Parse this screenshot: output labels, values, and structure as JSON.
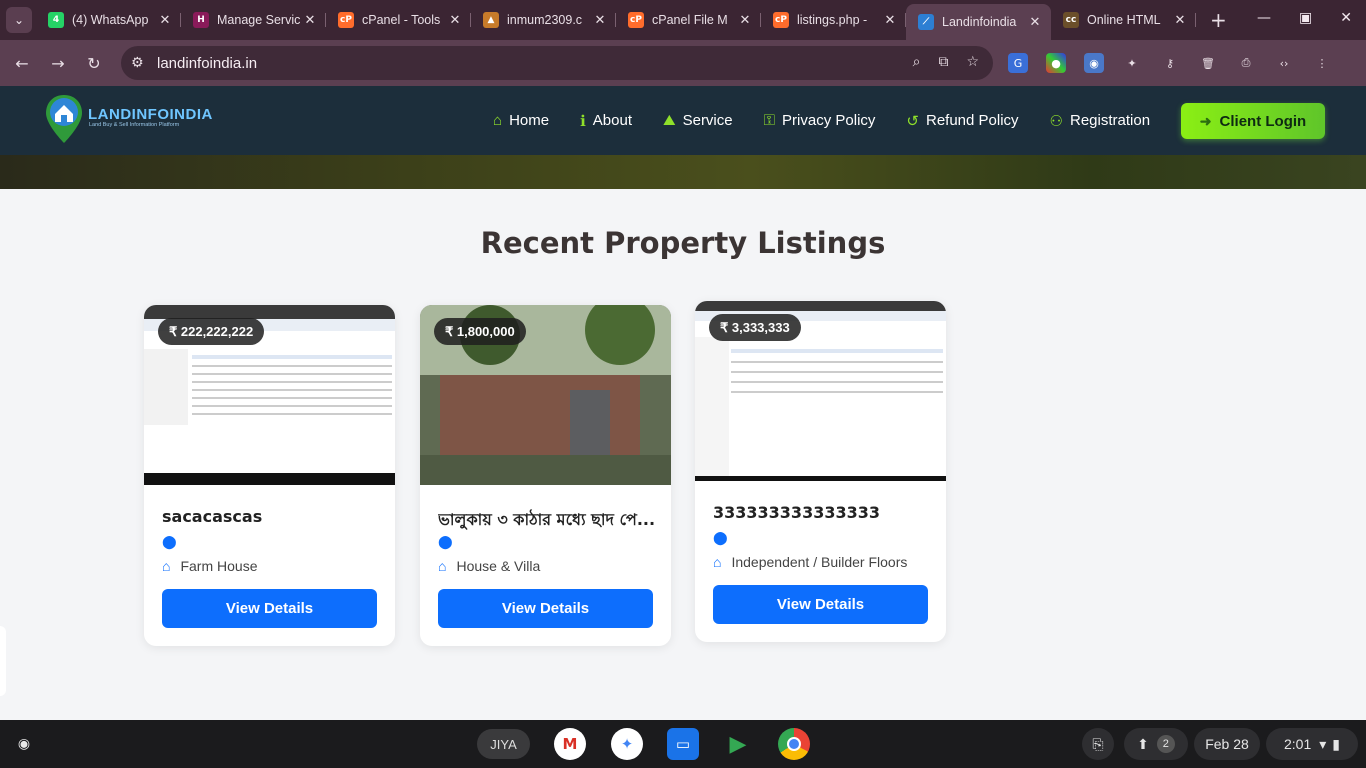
{
  "browser": {
    "tabs": [
      {
        "title": "(4) WhatsApp",
        "fav": "4",
        "favColor": "#25d366"
      },
      {
        "title": "Manage Servic",
        "fav": "H",
        "favColor": "#8a1b5a"
      },
      {
        "title": "cPanel - Tools",
        "fav": "cP",
        "favColor": "#ff6c2c"
      },
      {
        "title": "inmum2309.c",
        "fav": "▲",
        "favColor": "#c77b2a"
      },
      {
        "title": "cPanel File M",
        "fav": "cP",
        "favColor": "#ff6c2c"
      },
      {
        "title": "listings.php -",
        "fav": "cP",
        "favColor": "#ff6c2c"
      },
      {
        "title": "Landinfoindia",
        "fav": "⟋",
        "favColor": "#2d7fd3"
      },
      {
        "title": "Online HTML",
        "fav": "cc",
        "favColor": "#6b4f2a"
      }
    ],
    "url": "landinfoindia.in"
  },
  "site": {
    "logo_text": "LANDINFOINDIA",
    "logo_sub": "Land Buy & Sell Information Platform",
    "menu": [
      {
        "label": "Home",
        "icon": "home-icon",
        "glyph": "⌂"
      },
      {
        "label": "About",
        "icon": "info-icon",
        "glyph": "ℹ"
      },
      {
        "label": "Service",
        "icon": "service-icon",
        "glyph": "⛰"
      },
      {
        "label": "Privacy Policy",
        "icon": "user-shield-icon",
        "glyph": "⚿"
      },
      {
        "label": "Refund Policy",
        "icon": "undo-icon",
        "glyph": "↺"
      },
      {
        "label": "Registration",
        "icon": "user-plus-icon",
        "glyph": "⚇"
      }
    ],
    "login_label": "Client Login",
    "heading": "Recent Property Listings",
    "listings": [
      {
        "price": "₹ 222,222,222",
        "title": "sacacascas",
        "type": "Farm House",
        "button": "View Details"
      },
      {
        "price": "₹ 1,800,000",
        "title": "ভালুকায় ৩ কাঠার মধ্যে ছাদ পে...",
        "type": "House & Villa",
        "button": "View Details"
      },
      {
        "price": "₹ 3,333,333",
        "title": "333333333333333",
        "type": "Independent / Builder Floors",
        "button": "View Details"
      }
    ]
  },
  "shelf": {
    "desk_label": "JIYA",
    "notifications": "2",
    "date": "Feb 28",
    "time": "2:01"
  }
}
